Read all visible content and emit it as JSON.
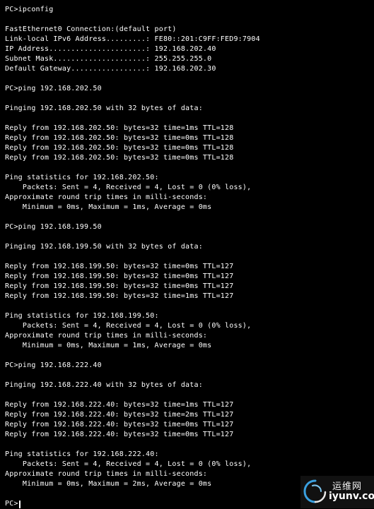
{
  "terminal": {
    "lines": [
      "PC>ipconfig",
      "",
      "FastEthernet0 Connection:(default port)",
      "Link-local IPv6 Address.........: FE80::201:C9FF:FED9:7904",
      "IP Address......................: 192.168.202.40",
      "Subnet Mask.....................: 255.255.255.0",
      "Default Gateway.................: 192.168.202.30",
      "",
      "PC>ping 192.168.202.50",
      "",
      "Pinging 192.168.202.50 with 32 bytes of data:",
      "",
      "Reply from 192.168.202.50: bytes=32 time=1ms TTL=128",
      "Reply from 192.168.202.50: bytes=32 time=0ms TTL=128",
      "Reply from 192.168.202.50: bytes=32 time=0ms TTL=128",
      "Reply from 192.168.202.50: bytes=32 time=0ms TTL=128",
      "",
      "Ping statistics for 192.168.202.50:",
      "    Packets: Sent = 4, Received = 4, Lost = 0 (0% loss),",
      "Approximate round trip times in milli-seconds:",
      "    Minimum = 0ms, Maximum = 1ms, Average = 0ms",
      "",
      "PC>ping 192.168.199.50",
      "",
      "Pinging 192.168.199.50 with 32 bytes of data:",
      "",
      "Reply from 192.168.199.50: bytes=32 time=0ms TTL=127",
      "Reply from 192.168.199.50: bytes=32 time=0ms TTL=127",
      "Reply from 192.168.199.50: bytes=32 time=0ms TTL=127",
      "Reply from 192.168.199.50: bytes=32 time=1ms TTL=127",
      "",
      "Ping statistics for 192.168.199.50:",
      "    Packets: Sent = 4, Received = 4, Lost = 0 (0% loss),",
      "Approximate round trip times in milli-seconds:",
      "    Minimum = 0ms, Maximum = 1ms, Average = 0ms",
      "",
      "PC>ping 192.168.222.40",
      "",
      "Pinging 192.168.222.40 with 32 bytes of data:",
      "",
      "Reply from 192.168.222.40: bytes=32 time=1ms TTL=127",
      "Reply from 192.168.222.40: bytes=32 time=2ms TTL=127",
      "Reply from 192.168.222.40: bytes=32 time=0ms TTL=127",
      "Reply from 192.168.222.40: bytes=32 time=0ms TTL=127",
      "",
      "Ping statistics for 192.168.222.40:",
      "    Packets: Sent = 4, Received = 4, Lost = 0 (0% loss),",
      "Approximate round trip times in milli-seconds:",
      "    Minimum = 0ms, Maximum = 2ms, Average = 0ms",
      ""
    ],
    "prompt": "PC>",
    "colors": {
      "background": "#000000",
      "text": "#ffffff"
    }
  },
  "watermark": {
    "brand_cn": "运维网",
    "domain": "iyunv.com",
    "logo_icon": "swirl-logo-icon"
  }
}
